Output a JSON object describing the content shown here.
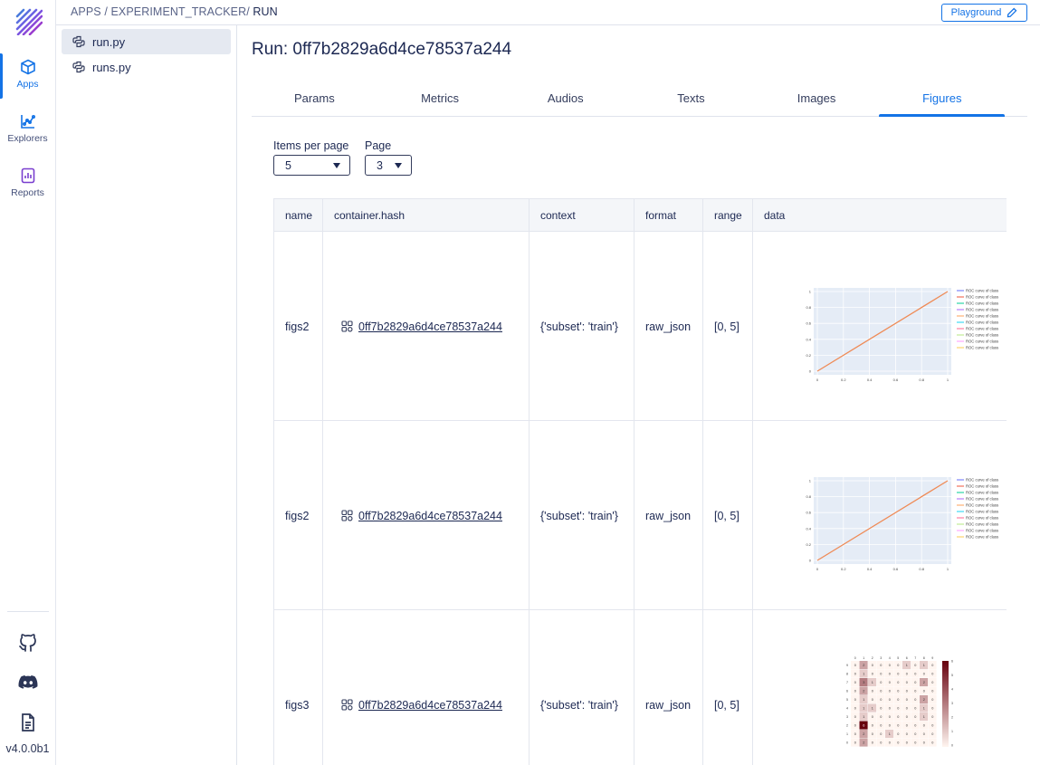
{
  "rail": {
    "items": [
      {
        "label": "Apps",
        "icon": "cube-icon"
      },
      {
        "label": "Explorers",
        "icon": "chart-icon"
      },
      {
        "label": "Reports",
        "icon": "report-icon"
      }
    ],
    "version": "v4.0.0b1"
  },
  "breadcrumb": {
    "apps": "APPS",
    "sep": "/",
    "tracker": "EXPERIMENT_TRACKER",
    "run": "RUN"
  },
  "playground_label": "Playground",
  "files": [
    "run.py",
    "runs.py"
  ],
  "run_title": "Run: 0ff7b2829a6d4ce78537a244",
  "tabs": [
    "Params",
    "Metrics",
    "Audios",
    "Texts",
    "Images",
    "Figures"
  ],
  "active_tab": "Figures",
  "controls": {
    "items_per_page_label": "Items per page",
    "items_per_page_value": "5",
    "page_label": "Page",
    "page_value": "3"
  },
  "table": {
    "columns": [
      "name",
      "container.hash",
      "context",
      "format",
      "range",
      "data"
    ],
    "rows": [
      {
        "name": "figs2",
        "hash": "0ff7b2829a6d4ce78537a244",
        "context": "{'subset': 'train'}",
        "format": "raw_json",
        "range": "[0, 5]",
        "figure": "roc"
      },
      {
        "name": "figs2",
        "hash": "0ff7b2829a6d4ce78537a244",
        "context": "{'subset': 'train'}",
        "format": "raw_json",
        "range": "[0, 5]",
        "figure": "roc"
      },
      {
        "name": "figs3",
        "hash": "0ff7b2829a6d4ce78537a244",
        "context": "{'subset': 'train'}",
        "format": "raw_json",
        "range": "[0, 5]",
        "figure": "heatmap"
      }
    ]
  },
  "roc_figure": {
    "legend_label": "ROC curve of class",
    "legend_count": 10,
    "ticks": [
      "0",
      "0.2",
      "0.4",
      "0.6",
      "0.8",
      "1"
    ],
    "line_colors": [
      "#636efa",
      "#ef553b",
      "#00cc96",
      "#ab63fa",
      "#ffa15a",
      "#19d3f3",
      "#ff6692",
      "#b6e880",
      "#ff97ff",
      "#fecb52"
    ]
  },
  "heatmap_figure": {
    "labels": [
      "0",
      "1",
      "2",
      "3",
      "4",
      "5",
      "6",
      "7",
      "8",
      "9"
    ],
    "colorbar_ticks": [
      "6",
      "5",
      "4",
      "3",
      "2",
      "1",
      "0"
    ],
    "matrix": [
      [
        0,
        2,
        0,
        0,
        0,
        0,
        1,
        0,
        1,
        0
      ],
      [
        0,
        1,
        0,
        0,
        0,
        0,
        0,
        0,
        0,
        0
      ],
      [
        0,
        3,
        1,
        0,
        0,
        0,
        0,
        0,
        2,
        0
      ],
      [
        0,
        2,
        0,
        0,
        0,
        0,
        0,
        0,
        0,
        0
      ],
      [
        0,
        1,
        0,
        0,
        0,
        0,
        0,
        0,
        2,
        0
      ],
      [
        0,
        1,
        1,
        0,
        0,
        0,
        0,
        0,
        1,
        0
      ],
      [
        0,
        1,
        0,
        0,
        0,
        0,
        0,
        0,
        1,
        0
      ],
      [
        0,
        6,
        0,
        0,
        0,
        0,
        0,
        0,
        0,
        0
      ],
      [
        0,
        2,
        0,
        0,
        1,
        0,
        0,
        0,
        0,
        0
      ],
      [
        0,
        2,
        0,
        0,
        0,
        0,
        0,
        0,
        0,
        0
      ]
    ]
  }
}
